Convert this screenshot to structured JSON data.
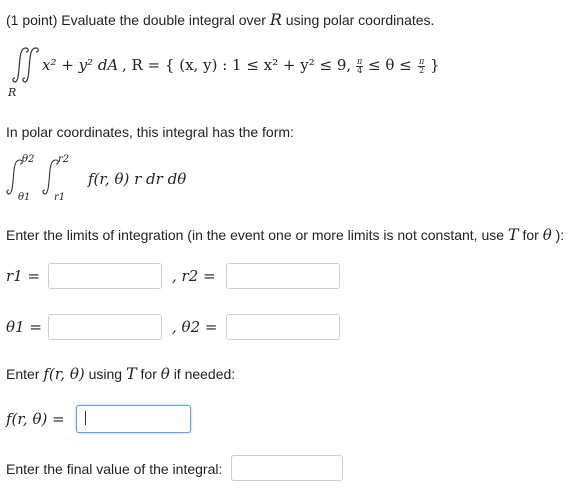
{
  "problem": {
    "points_label": "(1 point) Evaluate the double integral over",
    "region_symbol": "R",
    "method_suffix": "using polar coordinates."
  },
  "integral": {
    "subscript": "R",
    "integrand": "x² + y² dA",
    "region_def_prefix": ", R = { (x, y) : 1 ≤ x² + y² ≤ 9,",
    "theta_lower_num": "π",
    "theta_lower_den": "4",
    "theta_mid": "≤ θ ≤",
    "theta_upper_num": "π",
    "theta_upper_den": "2",
    "region_def_suffix": "}"
  },
  "polar_intro": "In polar coordinates, this integral has the form:",
  "polar_form": {
    "outer_upper": "θ2",
    "outer_lower": "θ1",
    "inner_upper": "r2",
    "inner_lower": "r1",
    "integrand": "f(r, θ) r dr dθ"
  },
  "limits_instruction": {
    "prefix": "Enter the limits of integration (in the event one or more limits is not constant, use",
    "T_symbol": "T",
    "mid": "for",
    "theta_symbol": "θ",
    "suffix": "):"
  },
  "fields": {
    "r1_label": "r1 =",
    "r2_label": ", r2 =",
    "theta1_label": "θ1 =",
    "theta2_label": ", θ2 =",
    "r1_value": "",
    "r2_value": "",
    "theta1_value": "",
    "theta2_value": ""
  },
  "f_instruction": {
    "prefix": "Enter",
    "f_symbol": "f(r, θ)",
    "mid": "using",
    "T_symbol": "T",
    "for_text": "for",
    "theta_symbol": "θ",
    "suffix": "if needed:"
  },
  "f_field": {
    "label": "f(r, θ) =",
    "value": ""
  },
  "final": {
    "label": "Enter the final value of the integral:",
    "value": ""
  }
}
